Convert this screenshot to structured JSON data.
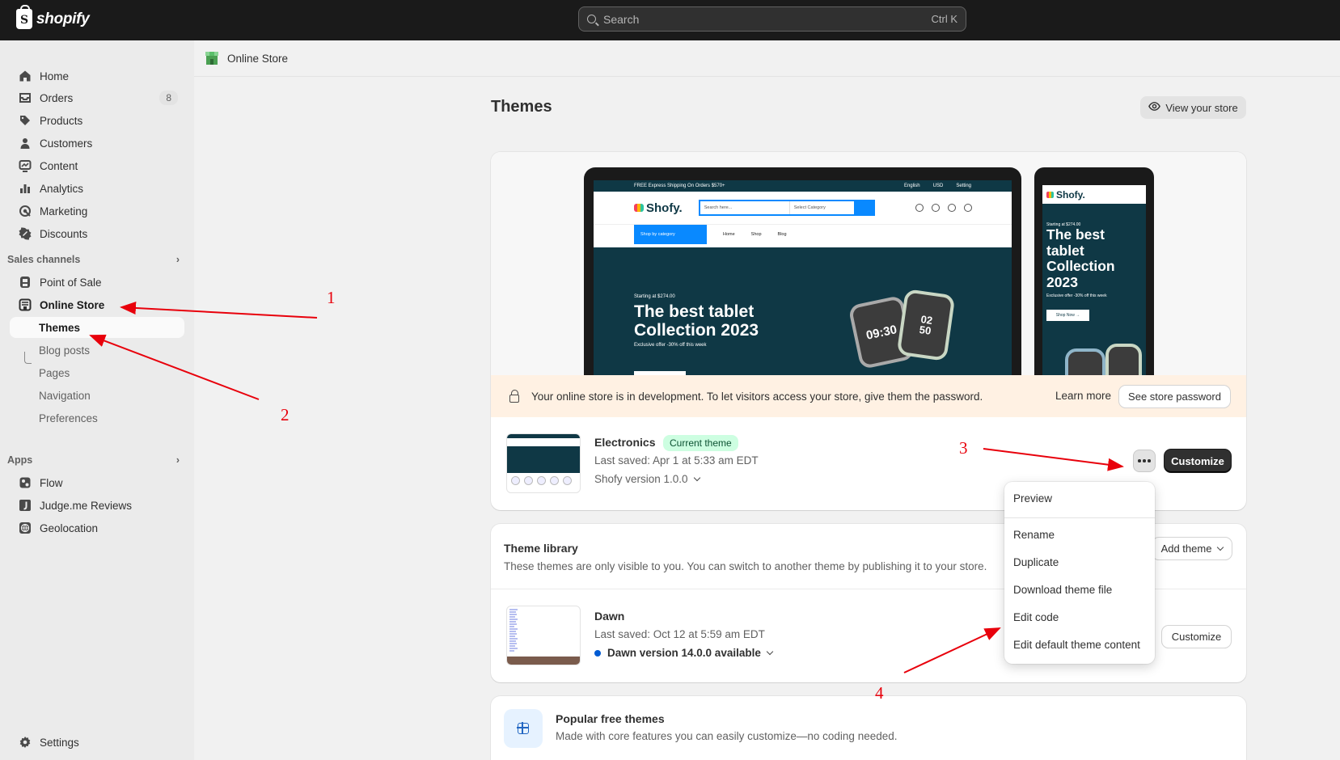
{
  "topbar": {
    "logo_text": "shopify",
    "search_placeholder": "Search",
    "search_shortcut": "Ctrl K"
  },
  "sidebar": {
    "items": [
      {
        "label": "Home",
        "icon": "home-icon"
      },
      {
        "label": "Orders",
        "icon": "orders-icon",
        "badge": "8"
      },
      {
        "label": "Products",
        "icon": "tag-icon"
      },
      {
        "label": "Customers",
        "icon": "person-icon"
      },
      {
        "label": "Content",
        "icon": "content-icon"
      },
      {
        "label": "Analytics",
        "icon": "bar-chart-icon"
      },
      {
        "label": "Marketing",
        "icon": "target-icon"
      },
      {
        "label": "Discounts",
        "icon": "discount-icon"
      }
    ],
    "sales_channels_label": "Sales channels",
    "channels": [
      {
        "label": "Point of Sale",
        "icon": "pos-icon"
      },
      {
        "label": "Online Store",
        "icon": "store-icon"
      }
    ],
    "online_store_sub": [
      "Themes",
      "Blog posts",
      "Pages",
      "Navigation",
      "Preferences"
    ],
    "apps_label": "Apps",
    "apps": [
      {
        "label": "Flow",
        "icon": "flow-icon"
      },
      {
        "label": "Judge.me Reviews",
        "icon": "judgeme-icon"
      },
      {
        "label": "Geolocation",
        "icon": "globe-icon"
      }
    ],
    "settings_label": "Settings"
  },
  "breadcrumb": "Online Store",
  "page": {
    "title": "Themes",
    "view_store_label": "View your store"
  },
  "preview": {
    "desktop": {
      "topstrip": "FREE Express Shipping On Orders $570+",
      "topstrip_right": [
        "English",
        "USD",
        "Setting"
      ],
      "logo": "Shofy.",
      "search_placeholder": "Search here...",
      "search_category": "Select Category",
      "nav_category": "Shop by category",
      "nav_links": [
        "Home",
        "Shop",
        "Blog"
      ],
      "hero_small": "Starting at $274.00",
      "hero_title_1": "The best tablet",
      "hero_title_2": "Collection 2023",
      "hero_offer": "Exclusive offer -30% off this week",
      "watch_1": "09:30",
      "watch_2a": "02",
      "watch_2b": "50"
    },
    "mobile": {
      "logo": "Shofy.",
      "hero_small": "Starting at $274.00",
      "hero_lines": [
        "The best",
        "tablet",
        "Collection",
        "2023"
      ],
      "hero_offer": "Exclusive offer -30% off this week",
      "button": "Shop Now →"
    }
  },
  "banner": {
    "text": "Your online store is in development. To let visitors access your store, give them the password.",
    "learn_more": "Learn more",
    "button": "See store password"
  },
  "current_theme": {
    "name": "Electronics",
    "badge": "Current theme",
    "last_saved": "Last saved: Apr 1 at 5:33 am EDT",
    "version": "Shofy version 1.0.0",
    "customize": "Customize"
  },
  "menu": {
    "items": [
      "Preview",
      "Rename",
      "Duplicate",
      "Download theme file",
      "Edit code",
      "Edit default theme content"
    ]
  },
  "library": {
    "title": "Theme library",
    "subtitle": "These themes are only visible to you. You can switch to another theme by publishing it to your store.",
    "add_theme": "Add theme",
    "theme": {
      "name": "Dawn",
      "last_saved": "Last saved: Oct 12 at 5:59 am EDT",
      "version": "Dawn version 14.0.0 available",
      "customize": "Customize"
    }
  },
  "popular": {
    "title": "Popular free themes",
    "subtitle": "Made with core features you can easily customize—no coding needed."
  },
  "annotations": [
    "1",
    "2",
    "3",
    "4"
  ],
  "colors": {
    "topbar": "#1a1a1a",
    "sidebar": "#ebebeb",
    "accent_green": "#cdfee1",
    "banner": "#fff1e3",
    "annotation_red": "#e8000b",
    "theme_teal": "#0f3845"
  }
}
